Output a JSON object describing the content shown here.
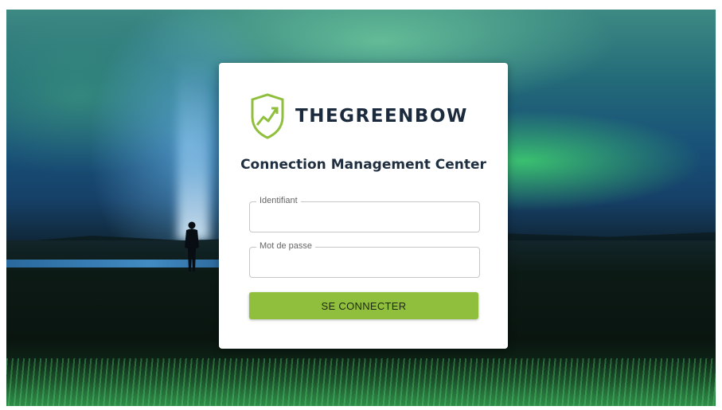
{
  "brand": {
    "name": "THEGREENBOW",
    "logo_icon": "shield-chart-icon",
    "accent_color": "#8fbf3c"
  },
  "login": {
    "title": "Connection Management Center",
    "username_label": "Identifiant",
    "username_value": "",
    "password_label": "Mot de passe",
    "password_value": "",
    "submit_label": "SE CONNECTER"
  },
  "background": {
    "description_icon": "aurora-landscape-image"
  }
}
